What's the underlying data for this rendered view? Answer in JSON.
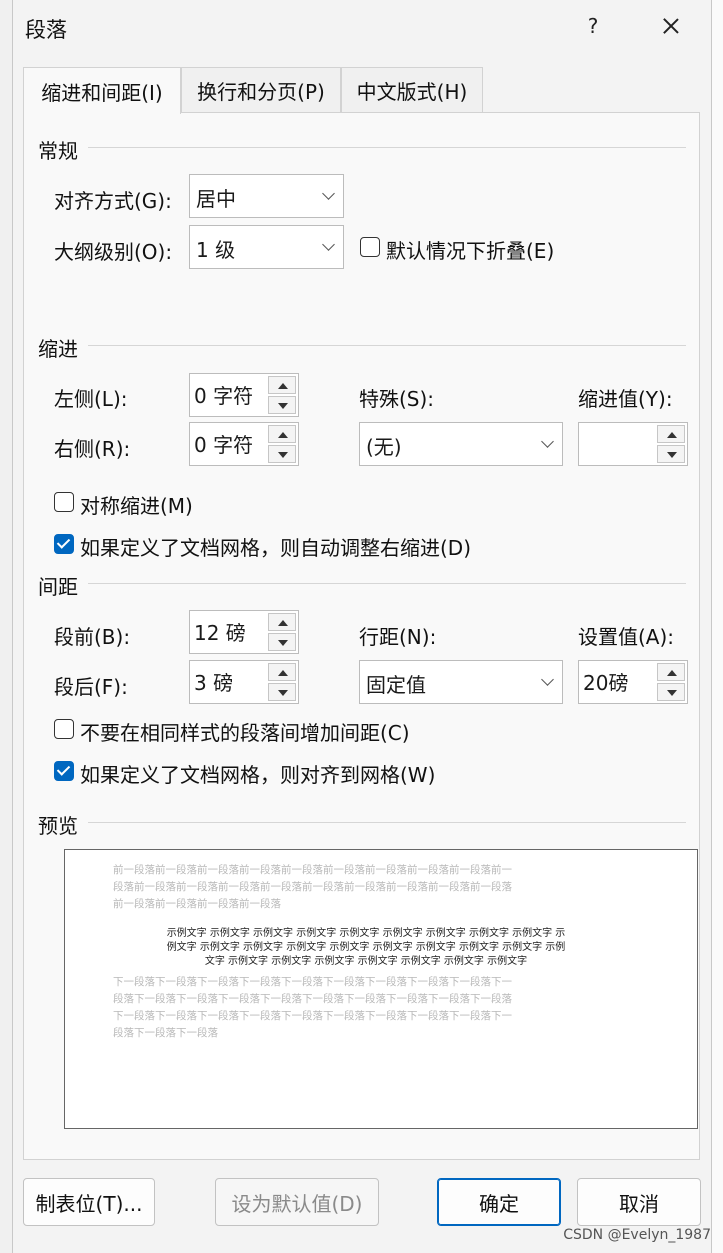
{
  "window": {
    "title": "段落",
    "help": "?"
  },
  "tabs": [
    {
      "label": "缩进和间距(I)",
      "active": true
    },
    {
      "label": "换行和分页(P)",
      "active": false
    },
    {
      "label": "中文版式(H)",
      "active": false
    }
  ],
  "general": {
    "title": "常规",
    "alignment_label": "对齐方式(G):",
    "alignment_value": "居中",
    "outline_label": "大纲级别(O):",
    "outline_value": "1 级",
    "collapse_label": "默认情况下折叠(E)",
    "collapse_checked": false
  },
  "indent": {
    "title": "缩进",
    "left_label": "左侧(L):",
    "left_value": "0 字符",
    "right_label": "右侧(R):",
    "right_value": "0 字符",
    "special_label": "特殊(S):",
    "special_value": "(无)",
    "by_label": "缩进值(Y):",
    "by_value": "",
    "mirror_label": "对称缩进(M)",
    "mirror_checked": false,
    "auto_right_label": "如果定义了文档网格，则自动调整右缩进(D)",
    "auto_right_checked": true
  },
  "spacing": {
    "title": "间距",
    "before_label": "段前(B):",
    "before_value": "12 磅",
    "after_label": "段后(F):",
    "after_value": "3 磅",
    "line_label": "行距(N):",
    "line_value": "固定值",
    "at_label": "设置值(A):",
    "at_value": "20磅",
    "no_space_label": "不要在相同样式的段落间增加间距(C)",
    "no_space_checked": false,
    "snap_grid_label": "如果定义了文档网格，则对齐到网格(W)",
    "snap_grid_checked": true
  },
  "preview": {
    "title": "预览",
    "prev_lines": [
      "前一段落前一段落前一段落前一段落前一段落前一段落前一段落前一段落前一段落前一",
      "段落前一段落前一段落前一段落前一段落前一段落前一段落前一段落前一段落前一段落",
      "前一段落前一段落前一段落前一段落"
    ],
    "sample_lines": [
      "示例文字  示例文字  示例文字  示例文字  示例文字  示例文字  示例文字  示例文字  示例文字  示",
      "例文字  示例文字  示例文字  示例文字  示例文字  示例文字  示例文字  示例文字  示例文字  示例",
      "文字  示例文字  示例文字  示例文字  示例文字  示例文字  示例文字  示例文字"
    ],
    "next_lines": [
      "下一段落下一段落下一段落下一段落下一段落下一段落下一段落下一段落下一段落下一",
      "段落下一段落下一段落下一段落下一段落下一段落下一段落下一段落下一段落下一段落",
      "下一段落下一段落下一段落下一段落下一段落下一段落下一段落下一段落下一段落下一",
      "段落下一段落下一段落"
    ]
  },
  "buttons": {
    "tabs": "制表位(T)...",
    "set_default": "设为默认值(D)",
    "ok": "确定",
    "cancel": "取消"
  },
  "watermark": "CSDN @Evelyn_1987"
}
